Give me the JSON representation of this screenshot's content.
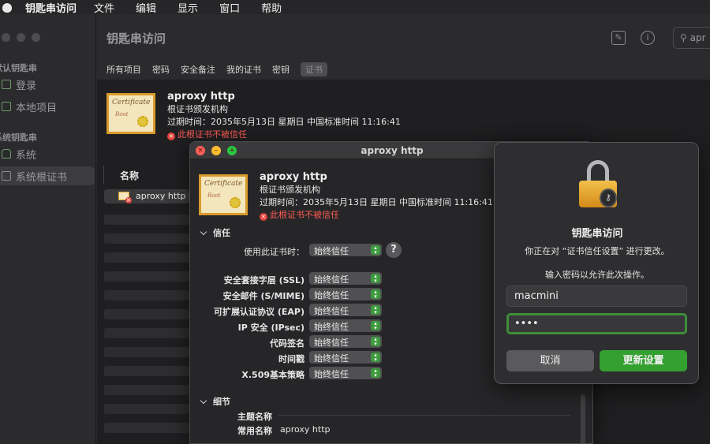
{
  "menubar": {
    "app": "钥匙串访问",
    "items": [
      "文件",
      "编辑",
      "显示",
      "窗口",
      "帮助"
    ]
  },
  "sidebar": {
    "section1": "默认钥匙串",
    "items1": [
      "登录",
      "本地项目"
    ],
    "section2": "系统钥匙串",
    "items2": [
      "系统",
      "系统根证书"
    ]
  },
  "toolbar": {
    "title": "钥匙串访问",
    "edit_icon": "compose-icon",
    "info_icon": "info-icon",
    "search_text": "apr"
  },
  "tabs": [
    "所有项目",
    "密码",
    "安全备注",
    "我的证书",
    "密钥",
    "证书"
  ],
  "cert": {
    "name": "aproxy http",
    "issuer": "根证书颁发机构",
    "expiry": "过期时间：2035年5月13日 星期日 中国标准时间 11:16:41",
    "error": "此根证书不被信任",
    "img_title": "Certificate",
    "img_sub": "Root"
  },
  "list": {
    "header": "名称",
    "selected_row": "aproxy http"
  },
  "detail": {
    "title": "aproxy http",
    "trust_header": "信任",
    "use_label": "使用此证书时：",
    "use_value": "始终信任",
    "help": "?",
    "rows": [
      {
        "label": "安全套接字层 (SSL)",
        "value": "始终信任"
      },
      {
        "label": "安全邮件 (S/MIME)",
        "value": "始终信任"
      },
      {
        "label": "可扩展认证协议 (EAP)",
        "value": "始终信任"
      },
      {
        "label": "IP 安全 (IPsec)",
        "value": "始终信任"
      },
      {
        "label": "代码签名",
        "value": "始终信任"
      },
      {
        "label": "时间戳",
        "value": "始终信任"
      },
      {
        "label": "X.509基本策略",
        "value": "始终信任"
      }
    ],
    "details_header": "细节",
    "subject_label": "主题名称",
    "common_name_label": "常用名称",
    "common_name_value": "aproxy http"
  },
  "auth": {
    "title": "钥匙串访问",
    "message": "你正在对 “证书信任设置” 进行更改。",
    "prompt": "输入密码以允许此次操作。",
    "username": "macmini",
    "password": "••••",
    "cancel": "取消",
    "ok": "更新设置"
  }
}
